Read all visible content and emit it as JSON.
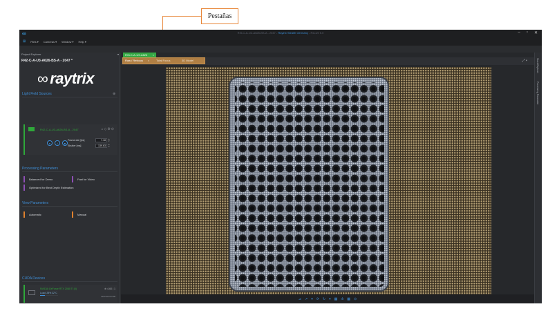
{
  "callout": {
    "label": "Pestañas"
  },
  "window": {
    "title_prefix": "RXLC-A-1/2-A626-BS-A - 2047 - ",
    "title_brand": "Raytrix Stealth Germany",
    "title_suffix": " - RxLive 5.0",
    "buttons": [
      "–",
      "▫",
      "✕"
    ]
  },
  "menu": {
    "items": [
      "Files ▾",
      "Cameras ▾",
      "Window ▾",
      "Help ▾"
    ]
  },
  "sidebar": {
    "header": "Project Explorer",
    "project_name": "R42-C-A-U3-A626-BS-A - 2047 *",
    "brand": "raytrix",
    "light_field_sources": {
      "title": "Light Field Sources",
      "camera_name": "R42-C-A-U3-A626-BS-A - 2047",
      "framerate_label": "Framerate [fps]",
      "framerate_value": "7.18",
      "shutter_label": "Shutter [ms]",
      "shutter_value": "139.63"
    },
    "processing": {
      "title": "Processing Parameters",
      "items": [
        "Balanced for Demo",
        "Fast for Video",
        "Optimized for Best Depth Estimation"
      ]
    },
    "view": {
      "title": "View Parameters",
      "items": [
        "Automatic",
        "Manual"
      ]
    },
    "cuda": {
      "title": "CUDA Devices",
      "device_name": "NVIDIA GeForce RTX 2080 Ti (0)",
      "load": "Load: 28%  32°C",
      "load_fraction": 0.28,
      "clock": "⊕ 4.60 | 1",
      "memory": "3222/11264 MB"
    }
  },
  "main": {
    "doc_tab": "RXLC-A-1/2-A626",
    "subtabs": [
      "Raw / Refocus",
      "Total Focus",
      "3D Model"
    ],
    "toolbar": [
      "⊿",
      "↗",
      "▾",
      "⟳",
      "↻",
      "▾",
      "▦",
      "ılı",
      "▦",
      "⊙"
    ]
  },
  "right_panel": {
    "tabs": [
      "Stack Explorer",
      "Processing Parameter"
    ]
  },
  "colors": {
    "accent_blue": "#3f8fd8",
    "accent_green": "#2fa83a",
    "purple": "#8e4fb5",
    "orange": "#e0812e",
    "callout": "#e8873a"
  }
}
